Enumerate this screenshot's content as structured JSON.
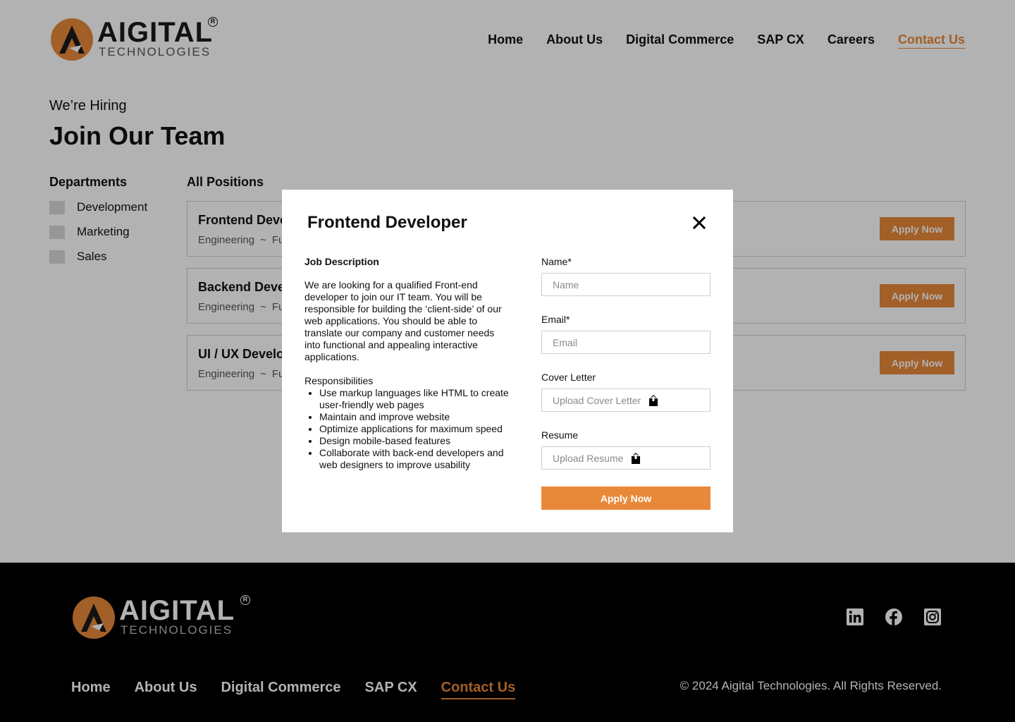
{
  "colors": {
    "accent": "#e8893a",
    "footer_bg": "#000000",
    "checkbox": "#d9d9d9"
  },
  "brand": {
    "name": "AIGITAL",
    "sub": "TECHNOLOGIES",
    "reg": "R"
  },
  "nav": {
    "items": [
      {
        "label": "Home",
        "active": false
      },
      {
        "label": "About Us",
        "active": false
      },
      {
        "label": "Digital Commerce",
        "active": false
      },
      {
        "label": "SAP CX",
        "active": false
      },
      {
        "label": "Careers",
        "active": false
      },
      {
        "label": "Contact Us",
        "active": true
      }
    ]
  },
  "hero": {
    "eyebrow": "We’re Hiring",
    "title": "Join Our Team"
  },
  "departments": {
    "title": "Departments",
    "items": [
      {
        "label": "Development",
        "checked": false
      },
      {
        "label": "Marketing",
        "checked": false
      },
      {
        "label": "Sales",
        "checked": false
      }
    ]
  },
  "positions": {
    "title": "All Positions",
    "jobs": [
      {
        "title": "Frontend Developer",
        "department": "Engineering",
        "separator": "~",
        "type": "Full-time",
        "apply_label": "Apply Now"
      },
      {
        "title": "Backend Developer",
        "department": "Engineering",
        "separator": "~",
        "type": "Full-time",
        "apply_label": "Apply Now"
      },
      {
        "title": "UI / UX Developer",
        "department": "Engineering",
        "separator": "~",
        "type": "Full-time",
        "apply_label": "Apply Now"
      }
    ]
  },
  "modal": {
    "title": "Frontend Developer",
    "close_icon": "close-icon",
    "job_description_heading": "Job Description",
    "job_description": "We are looking for a qualified Front-end developer to join our IT team. You will be responsible for building the ‘client-side’ of our web applications. You should be able to translate our company and customer needs into functional and appealing interactive applications.",
    "responsibilities_heading": "Responsibilities",
    "responsibilities": [
      "Use markup languages like HTML to create user-friendly web pages",
      "Maintain and improve website",
      "Optimize applications for maximum speed",
      "Design mobile-based features",
      "Collaborate with back-end developers and web designers to improve usability"
    ],
    "form": {
      "name_label": "Name*",
      "name_placeholder": "Name",
      "name_value": "",
      "email_label": "Email*",
      "email_placeholder": "Email",
      "email_value": "",
      "cover_label": "Cover Letter",
      "cover_upload": "Upload Cover Letter",
      "resume_label": "Resume",
      "resume_upload": "Upload Resume",
      "upload_icon": "upload-icon",
      "submit_label": "Apply Now"
    }
  },
  "footer": {
    "nav": [
      {
        "label": "Home",
        "active": false
      },
      {
        "label": "About Us",
        "active": false
      },
      {
        "label": "Digital Commerce",
        "active": false
      },
      {
        "label": "SAP CX",
        "active": false
      },
      {
        "label": "Contact Us",
        "active": true
      }
    ],
    "social": [
      "linkedin-icon",
      "facebook-icon",
      "instagram-icon"
    ],
    "copyright": "© 2024 Aigital Technologies. All Rights Reserved."
  }
}
